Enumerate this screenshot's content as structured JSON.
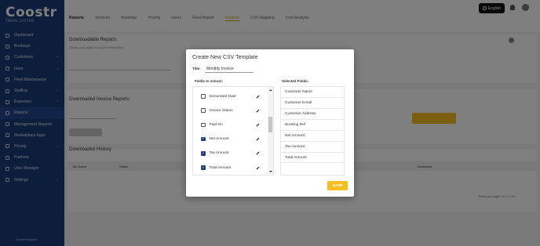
{
  "app": {
    "logo_text": "Coostr",
    "logo_tagline": "TRAVEL SYSTEM"
  },
  "sidebar": {
    "items": [
      {
        "label": "Dashboard"
      },
      {
        "label": "Bookings"
      },
      {
        "label": "Customers",
        "has_caret": true
      },
      {
        "label": "Fleet",
        "has_caret": true
      },
      {
        "label": "Fleet Maintenance"
      },
      {
        "label": "Staffing",
        "has_caret": true
      },
      {
        "label": "Expenses",
        "has_caret": true
      },
      {
        "label": "Reports",
        "active": true
      },
      {
        "label": "Management Reports"
      },
      {
        "label": "Marketplace Apps"
      },
      {
        "label": "Pricing",
        "has_caret": true
      },
      {
        "label": "Partners"
      },
      {
        "label": "User Manager"
      },
      {
        "label": "Settings",
        "has_caret": true
      }
    ],
    "footer": "Coostr Support"
  },
  "topbar": {
    "tabs": [
      "Reports",
      "Services",
      "Bookings",
      "Pricing",
      "Users",
      "Fleet Report",
      "Invoices",
      "CSV Mapping",
      "Cost Analysis"
    ],
    "language_button": "English"
  },
  "background": {
    "section1_title": "Downloadable Reports",
    "section1_subtitle": "Select your report to export information",
    "section2_title": "Downloaded Invoice Reports",
    "section3_title": "Downloaded History",
    "table_headers": [
      "Job Name",
      "Status",
      "",
      "",
      "",
      "Download Date",
      "",
      "Download"
    ],
    "pagination": "Rows per page: 10  1-1 of 1"
  },
  "modal": {
    "title": "Create New CSV Template",
    "title_label": "Title:",
    "title_value": "Monthly Invoice",
    "left_header": "Fields to extract:",
    "right_header": "Selected Fields:",
    "fields": [
      {
        "label": "Generated Date",
        "checked": false
      },
      {
        "label": "Invoice Status",
        "checked": false
      },
      {
        "label": "Paid On",
        "checked": false
      },
      {
        "label": "Net Amount",
        "checked": true
      },
      {
        "label": "Tax Amount",
        "checked": true
      },
      {
        "label": "Total Amount",
        "checked": true
      }
    ],
    "selected_fields": [
      "Customer Name",
      "Customer Email",
      "Customer Address",
      "Booking Ref",
      "Net Amount",
      "Tax Amount",
      "Total Amount"
    ],
    "save_label": "SAVE"
  },
  "colors": {
    "sidebar_bg": "#1a3a78",
    "accent_yellow": "#f5bf22",
    "checkbox_checked": "#1f3c7a",
    "overlay": "rgba(0,0,0,0.5)"
  }
}
